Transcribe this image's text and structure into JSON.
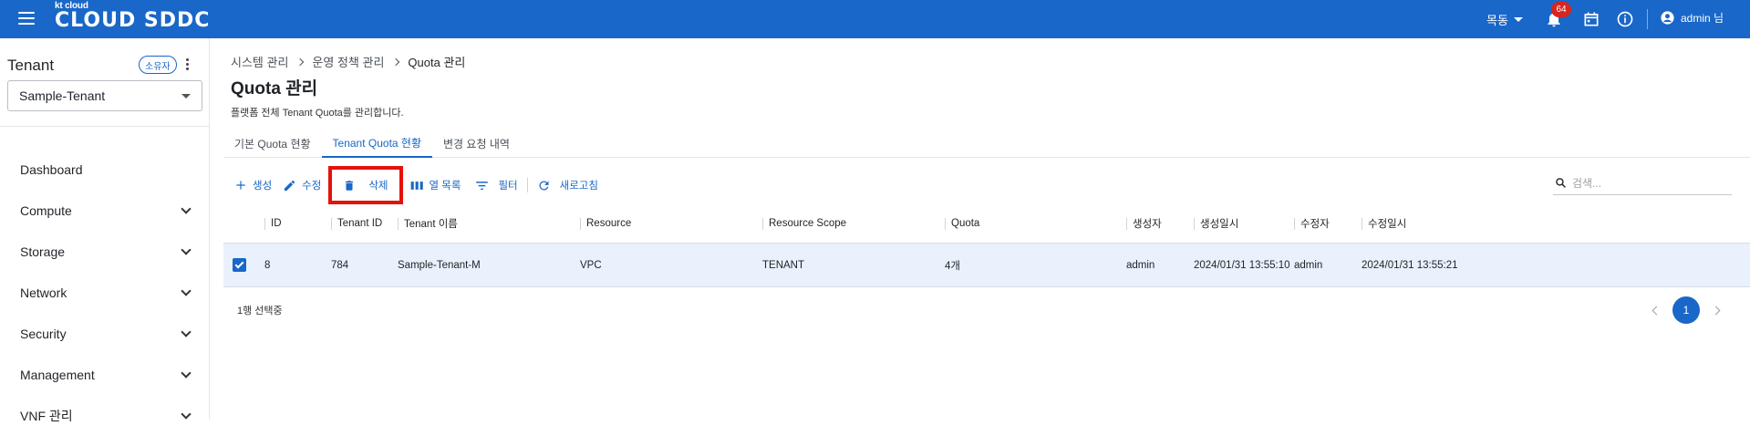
{
  "topbar": {
    "logo_small": "kt cloud",
    "logo_big": "CLOUD SDDC",
    "region": "목동",
    "notification_count": "64",
    "user": "admin 님"
  },
  "sidebar": {
    "tenant_title": "Tenant",
    "owner_badge": "소유자",
    "tenant_selected": "Sample-Tenant",
    "items": [
      {
        "label": "Dashboard"
      },
      {
        "label": "Compute"
      },
      {
        "label": "Storage"
      },
      {
        "label": "Network"
      },
      {
        "label": "Security"
      },
      {
        "label": "Management"
      },
      {
        "label": "VNF 관리"
      }
    ]
  },
  "breadcrumb": [
    "시스템 관리",
    "운영 정책 관리",
    "Quota 관리"
  ],
  "page": {
    "title": "Quota 관리",
    "description": "플랫폼 전체 Tenant Quota를 관리합니다."
  },
  "tabs": [
    "기본 Quota 현황",
    "Tenant Quota 현황",
    "변경 요청 내역"
  ],
  "active_tab": 1,
  "toolbar": {
    "create": "생성",
    "edit": "수정",
    "delete": "삭제",
    "columns": "열 목록",
    "filter": "필터",
    "refresh": "새로고침"
  },
  "search": {
    "placeholder": "검색..."
  },
  "table": {
    "headers": [
      "ID",
      "Tenant ID",
      "Tenant 이름",
      "Resource",
      "Resource Scope",
      "Quota",
      "생성자",
      "생성일시",
      "수정자",
      "수정일시"
    ],
    "rows": [
      [
        "8",
        "784",
        "Sample-Tenant-M",
        "VPC",
        "TENANT",
        "4개",
        "admin",
        "2024/01/31 13:55:10",
        "admin",
        "2024/01/31 13:55:21"
      ]
    ]
  },
  "footer": {
    "selected_text": "1행 선택중",
    "current_page": "1"
  },
  "colors": {
    "primary": "#1967c8",
    "highlight": "#e3120b",
    "selected_row": "#e8f1fc"
  }
}
